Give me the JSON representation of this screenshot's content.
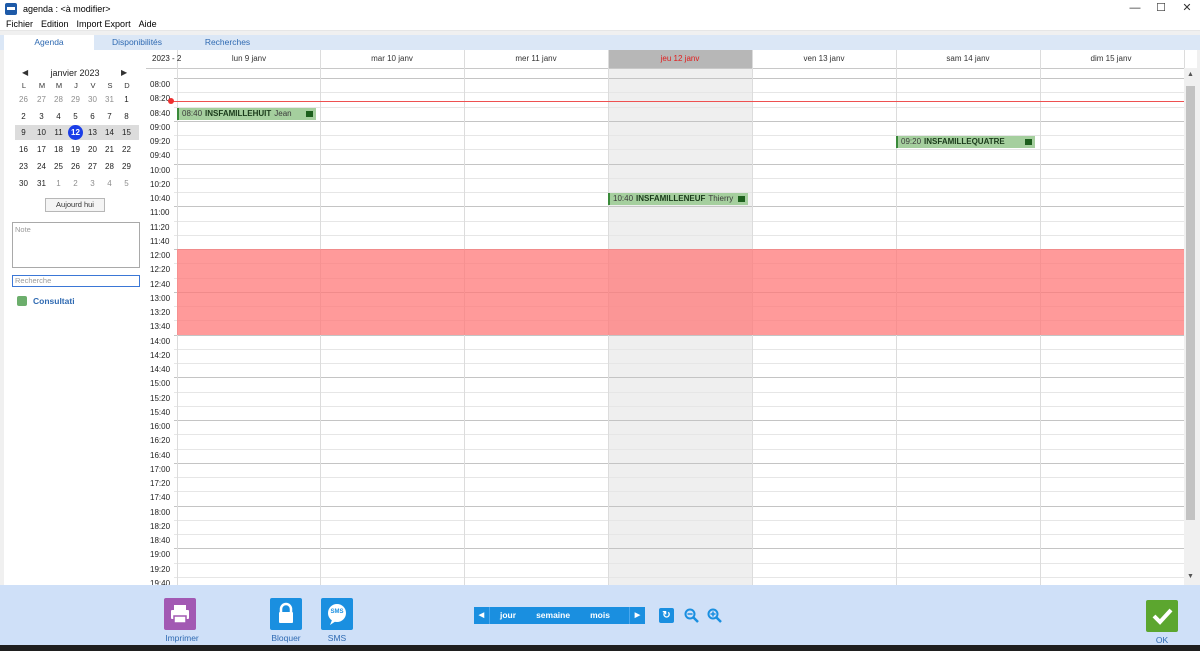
{
  "window": {
    "title": "agenda : <à modifier>",
    "controls": [
      "—",
      "☐",
      "✕"
    ]
  },
  "menu": [
    "Fichier",
    "Edition",
    "Import Export",
    "Aide"
  ],
  "tabs": [
    "Agenda",
    "Disponibilités",
    "Recherches"
  ],
  "mini_calendar": {
    "month_label": "janvier 2023",
    "day_headers": [
      "L",
      "M",
      "M",
      "J",
      "V",
      "S",
      "D"
    ],
    "weeks": [
      [
        "26",
        "27",
        "28",
        "29",
        "30",
        "31",
        "1"
      ],
      [
        "2",
        "3",
        "4",
        "5",
        "6",
        "7",
        "8"
      ],
      [
        "9",
        "10",
        "11",
        "12",
        "13",
        "14",
        "15"
      ],
      [
        "16",
        "17",
        "18",
        "19",
        "20",
        "21",
        "22"
      ],
      [
        "23",
        "24",
        "25",
        "26",
        "27",
        "28",
        "29"
      ],
      [
        "30",
        "31",
        "1",
        "2",
        "3",
        "4",
        "5"
      ]
    ],
    "today_button": "Aujourd hui"
  },
  "note_placeholder": "Note",
  "search_placeholder": "Recherche",
  "legend": {
    "label": "Consultati",
    "color": "#6cae6c"
  },
  "calendar": {
    "year_label": "2023 - 2",
    "columns": [
      "lun 9 janv",
      "mar 10 janv",
      "mer 11 janv",
      "jeu 12 janv",
      "ven 13 janv",
      "sam 14 janv",
      "dim 15 janv"
    ],
    "times": [
      "08:00",
      "08:20",
      "08:40",
      "09:00",
      "09:20",
      "09:40",
      "10:00",
      "10:20",
      "10:40",
      "11:00",
      "11:20",
      "11:40",
      "12:00",
      "12:20",
      "12:40",
      "13:00",
      "13:20",
      "13:40",
      "14:00",
      "14:20",
      "14:40",
      "15:00",
      "15:20",
      "15:40",
      "16:00",
      "16:20",
      "16:40",
      "17:00",
      "17:20",
      "17:40",
      "18:00",
      "18:20",
      "18:40",
      "19:00",
      "19:20",
      "19:40"
    ],
    "events": [
      {
        "time": "08:40",
        "name": "INSFAMILLEHUIT",
        "person": "Jean"
      },
      {
        "time": "09:20",
        "name": "INSFAMILLEQUATRE",
        "person": ""
      },
      {
        "time": "10:40",
        "name": "INSFAMILLENEUF",
        "person": "Thierry"
      }
    ]
  },
  "toolbar": {
    "print": "Imprimer",
    "block": "Bloquer",
    "sms": "SMS",
    "sms_icon_text": "SMS",
    "ok": "OK",
    "views": [
      "jour",
      "semaine",
      "mois"
    ]
  },
  "colors": {
    "accent": "#1a8fe0",
    "blocked": "#ff7878",
    "event": "#a5cf9e",
    "today": "#e01c1c"
  }
}
